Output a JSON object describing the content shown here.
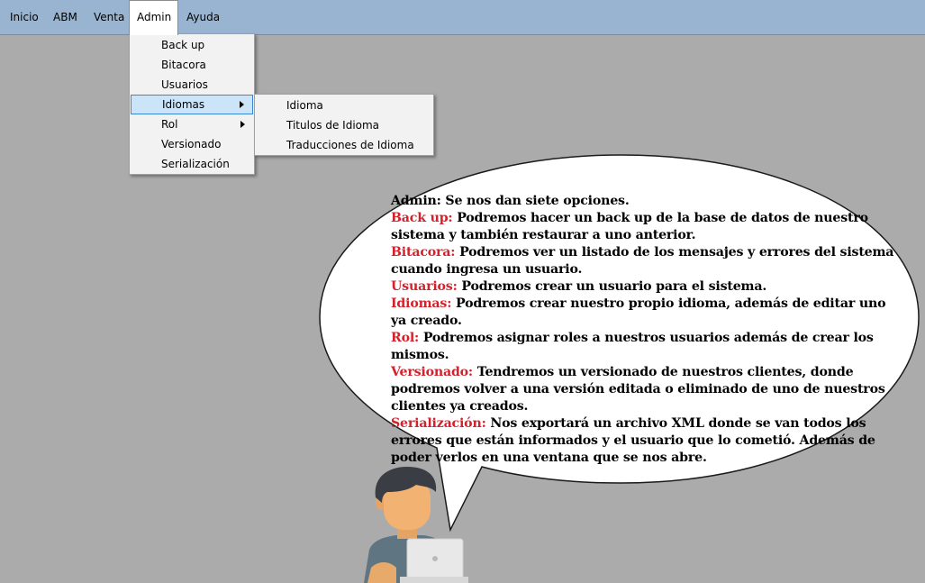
{
  "menubar": {
    "items": [
      "Inicio",
      "ABM",
      "Venta",
      "Admin",
      "Ayuda"
    ],
    "open_item": "Admin",
    "background": "#99b4d1"
  },
  "admin_menu": {
    "items": [
      {
        "label": "Back up",
        "submenu": false
      },
      {
        "label": "Bitacora",
        "submenu": false
      },
      {
        "label": "Usuarios",
        "submenu": false
      },
      {
        "label": "Idiomas",
        "submenu": true,
        "highlighted": true
      },
      {
        "label": "Rol",
        "submenu": true
      },
      {
        "label": "Versionado",
        "submenu": false
      },
      {
        "label": "Serialización",
        "submenu": false
      }
    ]
  },
  "idiomas_submenu": {
    "items": [
      "Idioma",
      "Titulos de Idioma",
      "Traducciones de Idioma"
    ]
  },
  "speech_bubble": {
    "intro_key": "Admin:",
    "intro_text": " Se nos dan siete opciones.",
    "entries": [
      {
        "key": "Back up:",
        "text": " Podremos hacer un back up de la base de datos de nuestro sistema y también restaurar a uno anterior."
      },
      {
        "key": "Bitacora:",
        "text": " Podremos ver un listado de los mensajes y errores del sistema cuando ingresa un usuario."
      },
      {
        "key": "Usuarios:",
        "text": " Podremos crear un usuario para el sistema."
      },
      {
        "key": "Idiomas:",
        "text": " Podremos crear nuestro propio idioma, además de editar uno ya creado."
      },
      {
        "key": "Rol:",
        "text": " Podremos asignar roles a nuestros usuarios además de crear los mismos."
      },
      {
        "key": "Versionado:",
        "text": " Tendremos un versionado de nuestros clientes, donde podremos volver a una versión editada o eliminado de uno de nuestros clientes ya creados."
      },
      {
        "key": "Serialización:",
        "text": " Nos exportará un archivo XML donde se van todos los errores que están informados y el usuario que lo cometió. Además de poder verlos en una ventana que se nos abre."
      }
    ],
    "key_color": "#d4212b"
  }
}
